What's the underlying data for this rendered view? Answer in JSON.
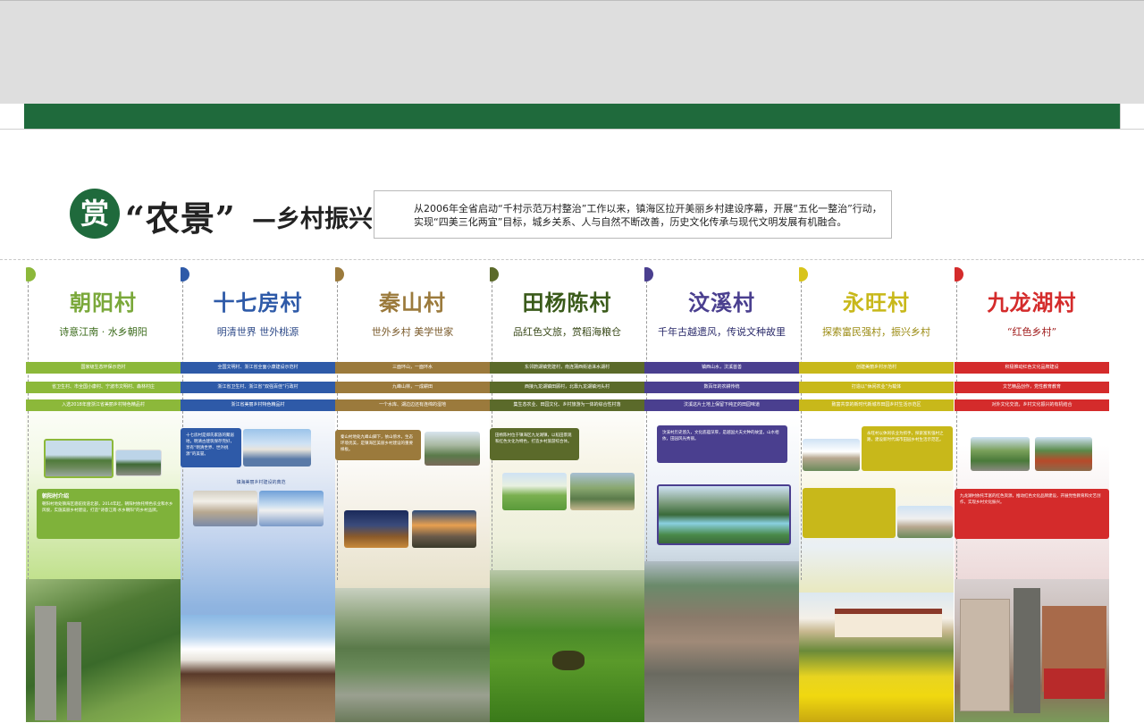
{
  "header": {
    "seal": "赏",
    "title": "“农景”",
    "subtitle": "—乡村振兴",
    "intro_line1": "从2006年全省启动“千村示范万村整治”工作以来，镇海区拉开美丽乡村建设序幕，开展“五化一整治”行动，",
    "intro_line2": "实现“四美三化两宜”目标，城乡关系、人与自然不断改善，历史文化传承与现代文明发展有机融合。"
  },
  "villages": [
    {
      "name": "朝阳村",
      "slogan": "诗意江南 · 水乡朝阳",
      "color": "#8cb83a",
      "honors": [
        "国家级生态环保示范村",
        "省卫生村、市全国小康村、宁波市文明村、森林村庄",
        "入选2018年度浙江省美丽乡村特色精品村"
      ],
      "box_title": "朝阳村介绍",
      "box_text": "朝阳村地处镇海区骆驼街道北部，2014年起，朝阳村依托特色农业和水乡风貌，实施美丽乡村建设，打造“诗意江南·水乡朝阳”的乡村品牌。"
    },
    {
      "name": "十七房村",
      "slogan": "明清世界 世外桃源",
      "color": "#2e5aa8",
      "honors": [
        "全国文明村、浙江省全面小康建设示范村",
        "浙江省卫生村、浙江省“双强百佳”行政村",
        "浙江省美丽乡村特色精品村"
      ],
      "box_title": "",
      "box_text": "十七房村是郑氏家族的聚居地，明清古建筑保存完好，享有“明清世界、世外桃源”的美誉。",
      "caption": "镇海美丽乡村建设的典范"
    },
    {
      "name": "秦山村",
      "slogan": "世外乡村 美学世家",
      "color": "#9b7a3c",
      "honors": [
        "三面环山，一面环水",
        "九峰山林，一成耕田",
        "一个水库、湖边边还有连绵的湿地"
      ],
      "box_title": "",
      "box_text": "秦山村地处九峰山脚下，依山傍水，生态环境优美，是镇海区美丽乡村建设的重要样板。"
    },
    {
      "name": "田杨陈村",
      "slogan": "品红色文旅，赏稻海粮仓",
      "color": "#5b6a2a",
      "honors": [
        "东邻蔚湖镇党建村，南连蒲西街道涞水湖村",
        "西接九龙湖镇田顾村，北靠九龙湖镇河头村",
        "集生态农业、田园文化、乡村旅游为一体的综合性村落"
      ],
      "box_title": "",
      "box_text": "田杨陈村位于镇海区九龙湖镇，以稻田景观和红色文化为特色，打造乡村旅游综合体。"
    },
    {
      "name": "汶溪村",
      "slogan": "千年古越遗风，传说文种故里",
      "color": "#4a3f8f",
      "honors": [
        "镇西山水，汶溪首善",
        "数百年的农耕传统",
        "汶溪这片土地上保留下纯正的田园味道"
      ],
      "box_title": "",
      "box_text": "汶溪村历史悠久，文化底蕴深厚，是越国大夫文种的故里，山水相依，田园风光秀丽。"
    },
    {
      "name": "永旺村",
      "slogan": "探索富民强村，振兴乡村",
      "color": "#c8b81a",
      "honors": [
        "创建美丽乡村示范村",
        "打造以“休闲农业”为载体",
        "致富共享的新时代新城市田园乡村生活示范区"
      ],
      "box_title": "",
      "box_text": "永旺村以休闲农业为抓手，探索富民强村之路，建设新时代城市田园乡村生活示范区。"
    },
    {
      "name": "九龙湖村",
      "slogan": "“红色乡村”",
      "color": "#d42b2b",
      "honors": [
        "积极推动红色文化品牌建设",
        "文艺精品创作，党性教育教育",
        "对外文化交流，乡村文化振兴的有机结合"
      ],
      "box_title": "",
      "box_text": "九龙湖村依托丰富的红色资源，推动红色文化品牌建设，开展党性教育和文艺创作，实现乡村文化振兴。"
    }
  ]
}
